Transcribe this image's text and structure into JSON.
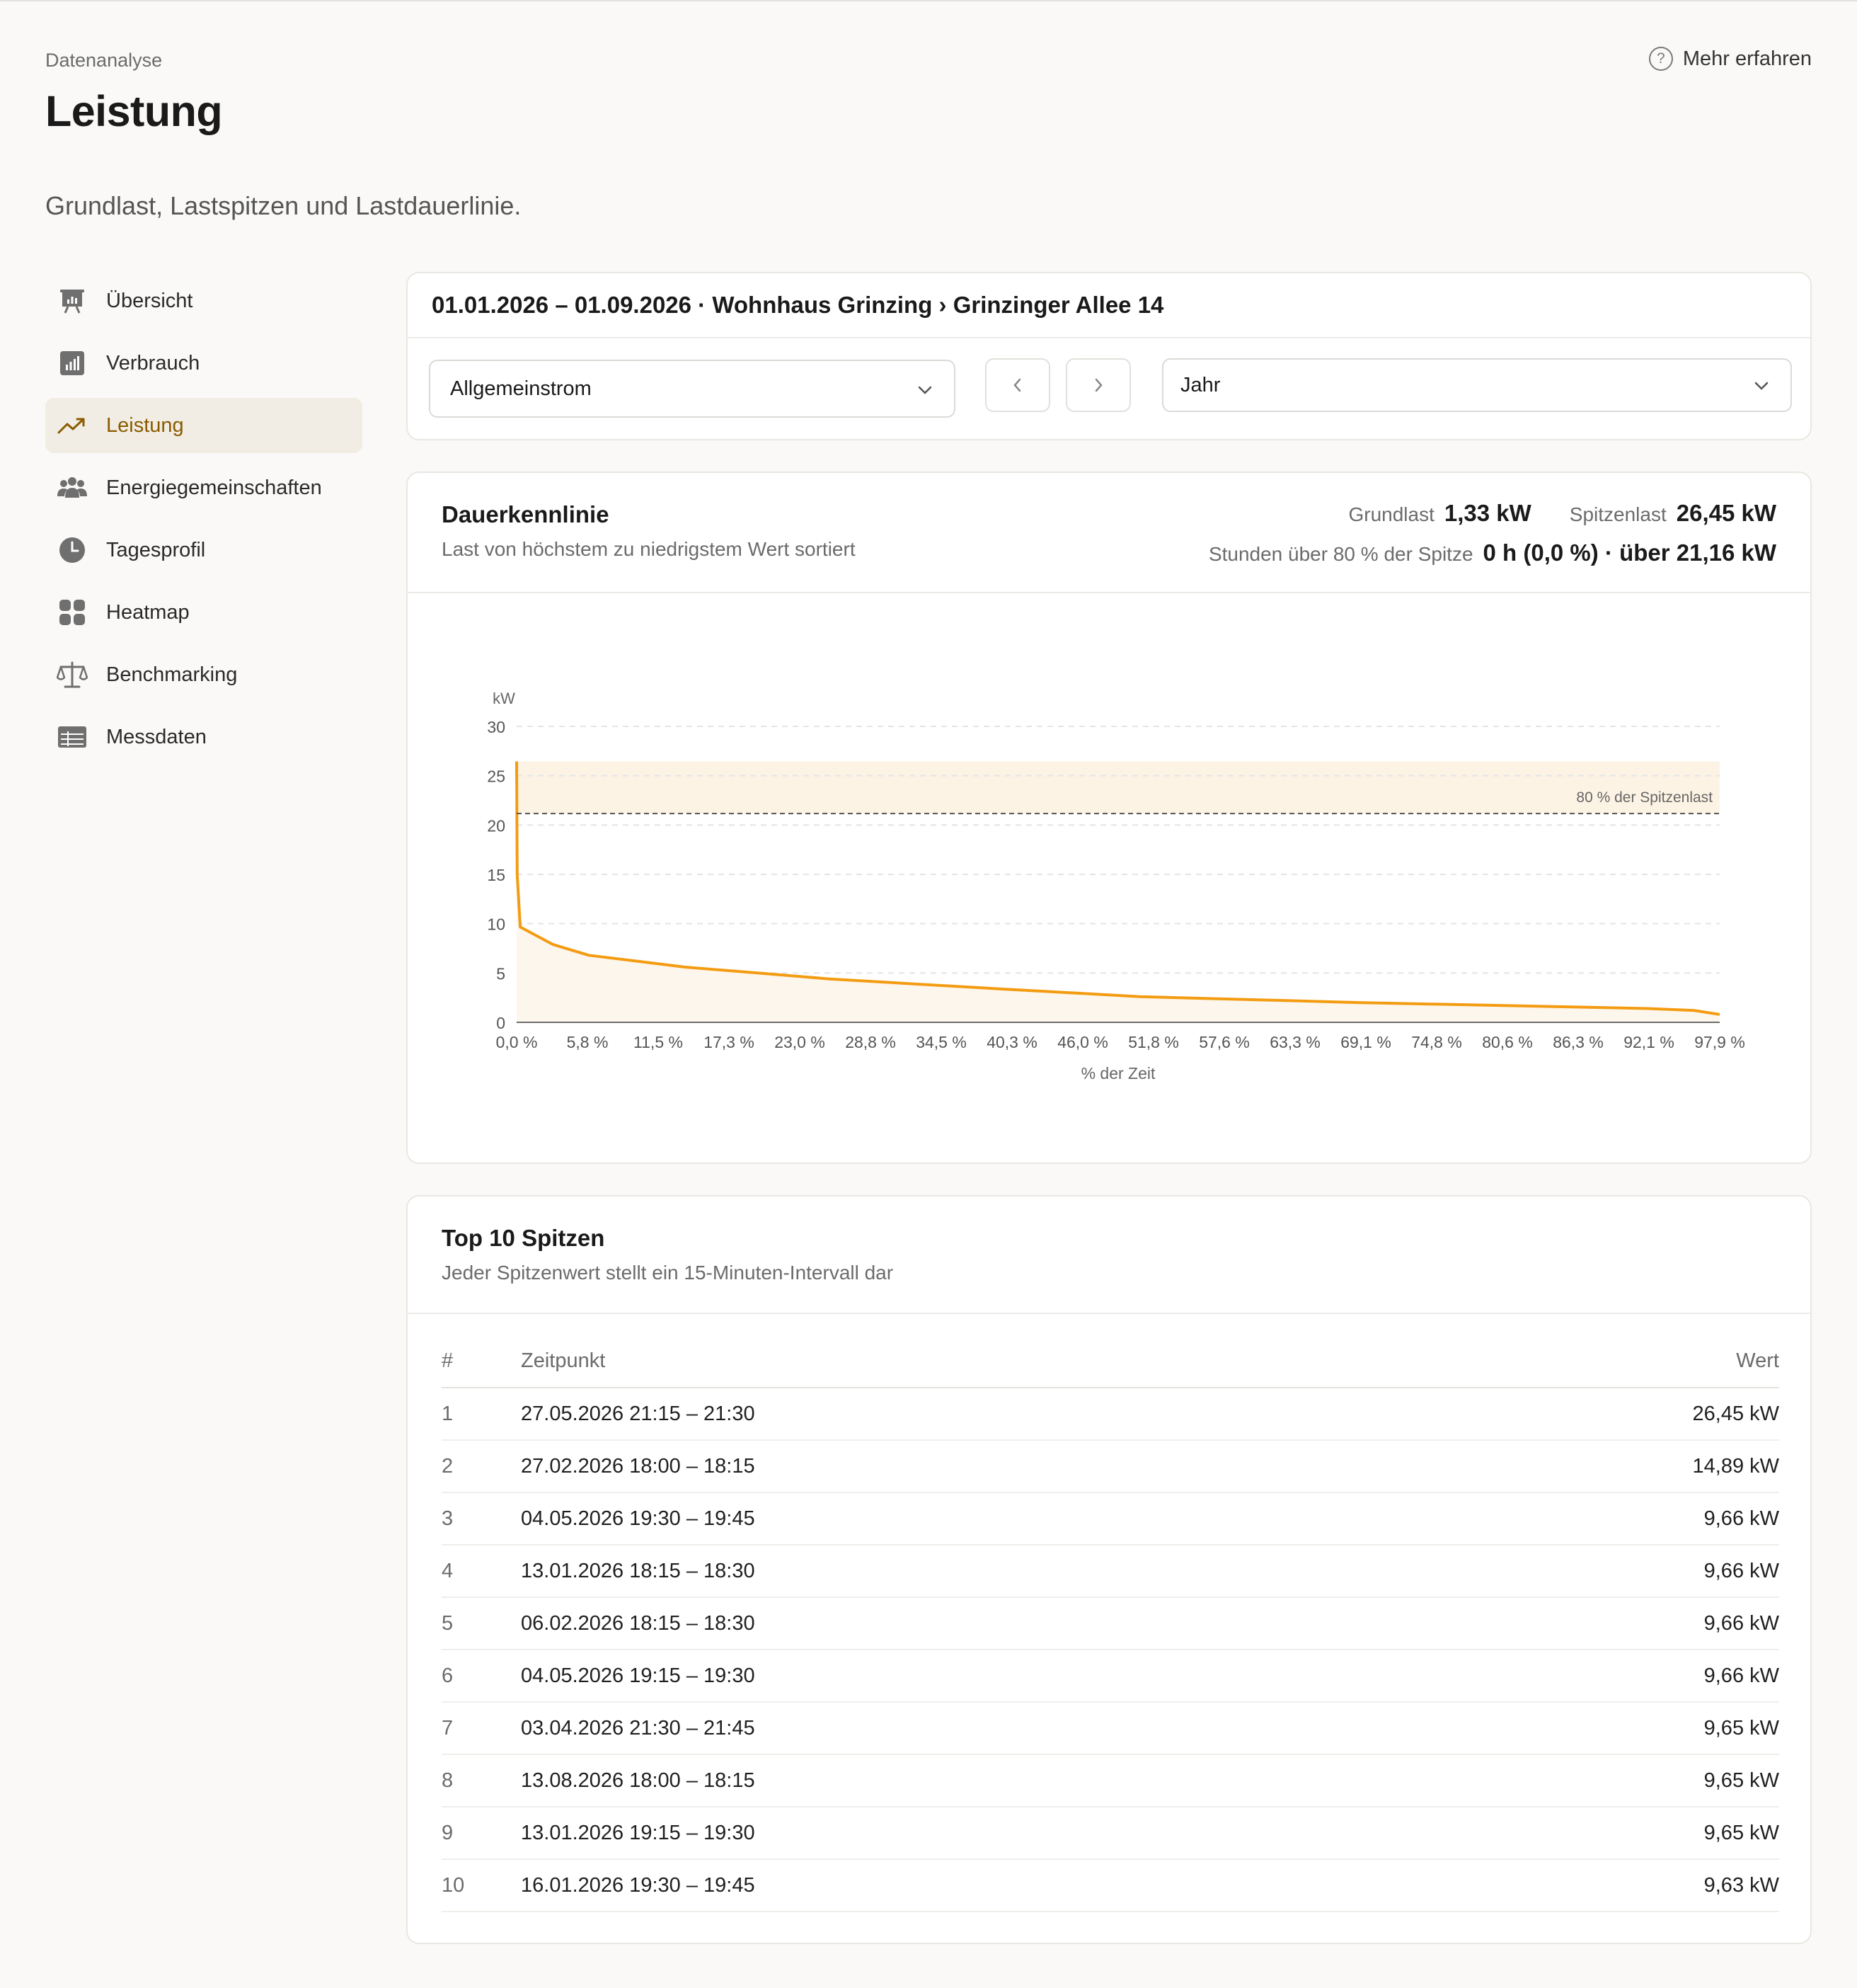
{
  "header": {
    "eyebrow": "Datenanalyse",
    "title": "Leistung",
    "subtitle": "Grundlast, Lastspitzen und Lastdauerlinie.",
    "learn_more": "Mehr erfahren"
  },
  "sidebar": {
    "items": [
      {
        "label": "Übersicht",
        "icon": "presentation-chart-icon"
      },
      {
        "label": "Verbrauch",
        "icon": "bar-chart-icon"
      },
      {
        "label": "Leistung",
        "icon": "trending-up-icon",
        "active": true
      },
      {
        "label": "Energiegemeinschaften",
        "icon": "users-group-icon"
      },
      {
        "label": "Tagesprofil",
        "icon": "clock-icon"
      },
      {
        "label": "Heatmap",
        "icon": "grid-icon"
      },
      {
        "label": "Benchmarking",
        "icon": "scale-icon"
      },
      {
        "label": "Messdaten",
        "icon": "table-icon"
      }
    ]
  },
  "filter": {
    "breadcrumb": "01.01.2026 – 01.09.2026 · Wohnhaus Grinzing › Grinzinger Allee 14",
    "meter_select": "Allgemeinstrom",
    "period_select": "Jahr"
  },
  "duration_card": {
    "title": "Dauerkennlinie",
    "subtitle": "Last von höchstem zu niedrigstem Wert sortiert",
    "base_label": "Grundlast",
    "base_value": "1,33 kW",
    "peak_label": "Spitzenlast",
    "peak_value": "26,45 kW",
    "hours_label": "Stunden über 80 % der Spitze",
    "hours_value": "0 h (0,0 %) · über 21,16 kW"
  },
  "chart_data": {
    "type": "area",
    "ylabel": "kW",
    "xlabel": "% der Zeit",
    "ylim": [
      0,
      30
    ],
    "yticks": [
      "0",
      "5",
      "10",
      "15",
      "20",
      "25",
      "30"
    ],
    "xticks": [
      "0,0 %",
      "5,8 %",
      "11,5 %",
      "17,3 %",
      "23,0 %",
      "28,8 %",
      "34,5 %",
      "40,3 %",
      "46,0 %",
      "51,8 %",
      "57,6 %",
      "63,3 %",
      "69,1 %",
      "74,8 %",
      "80,6 %",
      "86,3 %",
      "92,1 %",
      "97,9 %"
    ],
    "xlim": [
      0,
      100
    ],
    "grid": true,
    "series": [
      {
        "x": [
          0,
          0.05,
          0.3,
          3,
          6,
          10,
          14,
          20,
          26,
          33,
          40,
          46,
          51.8,
          58,
          64,
          70,
          76,
          82,
          88,
          94,
          97.9,
          100
        ],
        "y": [
          26.45,
          15,
          9.66,
          7.9,
          6.8,
          6.2,
          5.6,
          5.0,
          4.4,
          3.9,
          3.4,
          3.0,
          2.6,
          2.4,
          2.2,
          2.0,
          1.85,
          1.7,
          1.55,
          1.4,
          1.2,
          0.8
        ]
      }
    ],
    "band": {
      "from": 21.16,
      "to": 26.45
    },
    "reference_line": {
      "y": 21.16,
      "label": "80 % der Spitzenlast"
    },
    "colors": {
      "line": "#f39c12",
      "band": "#fdf3e4",
      "ref": "#555555"
    }
  },
  "peaks_card": {
    "title": "Top 10 Spitzen",
    "subtitle": "Jeder Spitzenwert stellt ein 15-Minuten-Intervall dar",
    "columns": [
      "#",
      "Zeitpunkt",
      "Wert"
    ],
    "rows": [
      {
        "rank": "1",
        "time": "27.05.2026 21:15 – 21:30",
        "value": "26,45 kW"
      },
      {
        "rank": "2",
        "time": "27.02.2026 18:00 – 18:15",
        "value": "14,89 kW"
      },
      {
        "rank": "3",
        "time": "04.05.2026 19:30 – 19:45",
        "value": "9,66 kW"
      },
      {
        "rank": "4",
        "time": "13.01.2026 18:15 – 18:30",
        "value": "9,66 kW"
      },
      {
        "rank": "5",
        "time": "06.02.2026 18:15 – 18:30",
        "value": "9,66 kW"
      },
      {
        "rank": "6",
        "time": "04.05.2026 19:15 – 19:30",
        "value": "9,66 kW"
      },
      {
        "rank": "7",
        "time": "03.04.2026 21:30 – 21:45",
        "value": "9,65 kW"
      },
      {
        "rank": "8",
        "time": "13.08.2026 18:00 – 18:15",
        "value": "9,65 kW"
      },
      {
        "rank": "9",
        "time": "13.01.2026 19:15 – 19:30",
        "value": "9,65 kW"
      },
      {
        "rank": "10",
        "time": "16.01.2026 19:30 – 19:45",
        "value": "9,63 kW"
      }
    ]
  },
  "colors": {
    "accent": "#8a5b00",
    "active_bg": "#f1ede4",
    "background": "#faf9f7"
  }
}
